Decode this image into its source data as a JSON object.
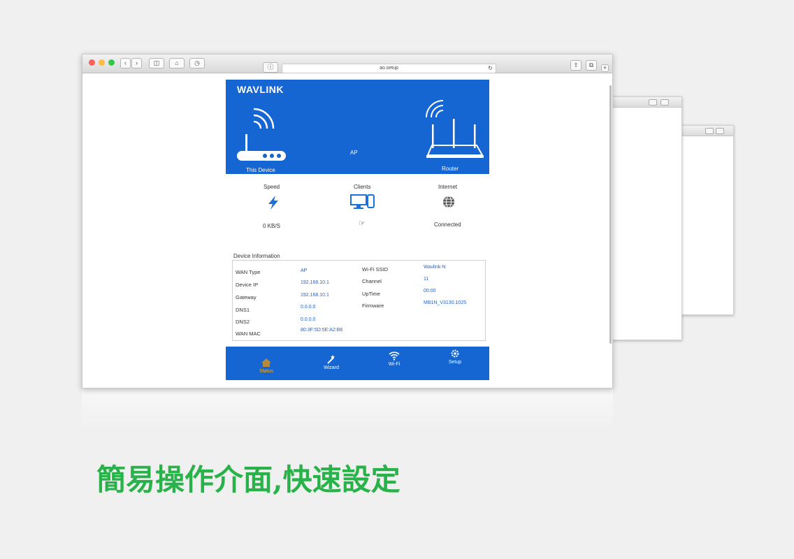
{
  "browser": {
    "url": "ao.setup"
  },
  "header": {
    "logo": "WAVLINK",
    "this_device_label": "This Device",
    "mode_label": "AP",
    "router_label": "Router"
  },
  "stats": {
    "speed": {
      "title": "Speed",
      "value": "0 KB/S"
    },
    "clients": {
      "title": "Clients"
    },
    "internet": {
      "title": "Internet",
      "value": "Connected"
    }
  },
  "device_info": {
    "title": "Device Information",
    "left": [
      {
        "key": "WAN Type",
        "value": "AP"
      },
      {
        "key": "Device IP",
        "value": "192.168.10.1"
      },
      {
        "key": "Gateway",
        "value": "192.168.10.1"
      },
      {
        "key": "DNS1",
        "value": "0.0.0.0"
      },
      {
        "key": "DNS2",
        "value": "0.0.0.0"
      },
      {
        "key": "WAN MAC",
        "value": "80:3F:5D:5E:A2:B6"
      }
    ],
    "right": [
      {
        "key": "Wi-Fi SSID",
        "value": "Wavlink-N"
      },
      {
        "key": "Channel",
        "value": "11"
      },
      {
        "key": "UpTime",
        "value": "00:00"
      },
      {
        "key": "Firmware",
        "value": "MB1N_V3130.1025"
      }
    ]
  },
  "nav": {
    "status": "Status",
    "wizard": "Wizard",
    "wifi": "Wi-Fi",
    "setup": "Setup"
  },
  "caption": "簡易操作介面,快速設定",
  "colors": {
    "brand_blue": "#1565d3",
    "caption_green": "#2ab24a"
  }
}
